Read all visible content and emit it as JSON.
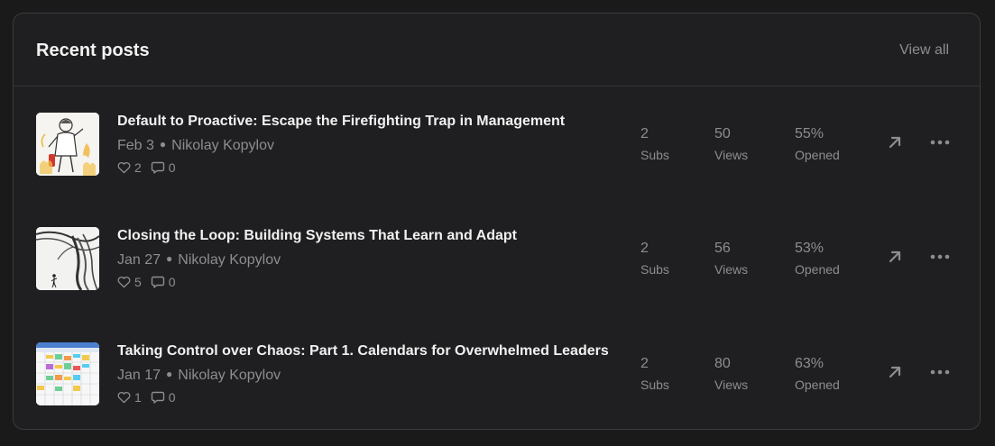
{
  "header": {
    "title": "Recent posts",
    "view_all_label": "View all"
  },
  "stat_labels": {
    "subs": "Subs",
    "views": "Views",
    "opened": "Opened"
  },
  "posts": [
    {
      "title": "Default to Proactive: Escape the Firefighting Trap in Management",
      "date": "Feb 3",
      "author": "Nikolay Kopylov",
      "likes": "2",
      "comments": "0",
      "subs": "2",
      "views": "50",
      "opened": "55%",
      "thumbnail": "firefighter-illustration"
    },
    {
      "title": "Closing the Loop: Building Systems That Learn and Adapt",
      "date": "Jan 27",
      "author": "Nikolay Kopylov",
      "likes": "5",
      "comments": "0",
      "subs": "2",
      "views": "56",
      "opened": "53%",
      "thumbnail": "tree-loop-illustration"
    },
    {
      "title": "Taking Control over Chaos: Part 1. Calendars for Overwhelmed Leaders",
      "date": "Jan 17",
      "author": "Nikolay Kopylov",
      "likes": "1",
      "comments": "0",
      "subs": "2",
      "views": "80",
      "opened": "63%",
      "thumbnail": "calendar-screenshot"
    }
  ],
  "colors": {
    "background": "#1a1a1b",
    "card": "#1f1f21",
    "title_text": "#f1f1f1",
    "muted_text": "#8c8d91",
    "border": "#3a3b3e"
  }
}
